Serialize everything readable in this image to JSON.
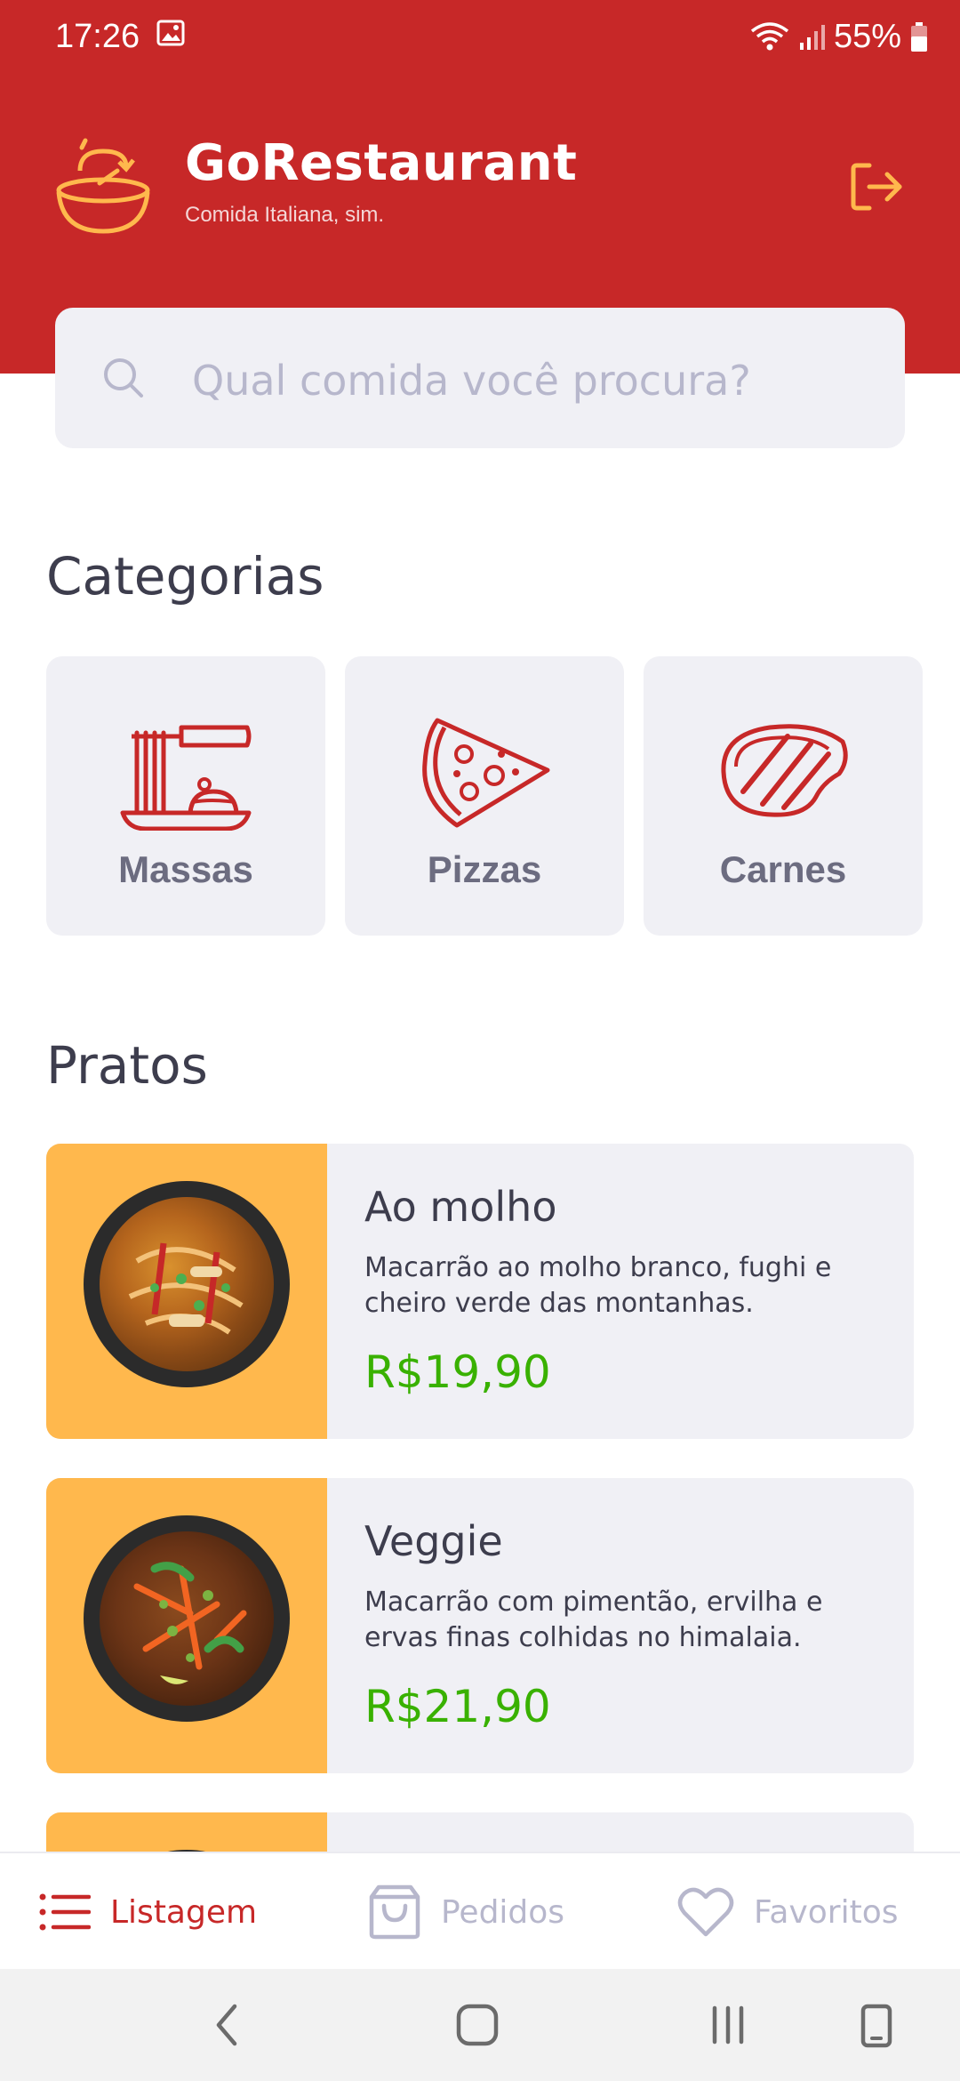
{
  "status": {
    "time": "17:26",
    "battery": "55%"
  },
  "header": {
    "title": "GoRestaurant",
    "subtitle": "Comida Italiana, sim."
  },
  "search": {
    "placeholder": "Qual comida você procura?"
  },
  "categories_section": {
    "title": "Categorias",
    "items": [
      {
        "label": "Massas",
        "icon": "pasta-icon"
      },
      {
        "label": "Pizzas",
        "icon": "pizza-icon"
      },
      {
        "label": "Carnes",
        "icon": "steak-icon"
      }
    ]
  },
  "dishes_section": {
    "title": "Pratos",
    "items": [
      {
        "name": "Ao molho",
        "description": "Macarrão ao molho branco, fughi e cheiro verde das montanhas.",
        "price": "R$19,90"
      },
      {
        "name": "Veggie",
        "description": "Macarrão com pimentão, ervilha e ervas finas colhidas no himalaia.",
        "price": "R$21,90"
      }
    ]
  },
  "tabs": [
    {
      "label": "Listagem",
      "icon": "list-icon",
      "active": true
    },
    {
      "label": "Pedidos",
      "icon": "shopping-bag-icon",
      "active": false
    },
    {
      "label": "Favoritos",
      "icon": "heart-icon",
      "active": false
    }
  ],
  "colors": {
    "primary": "#c72828",
    "accent": "#ffb84d",
    "price": "#39b100",
    "card": "#f0f0f5",
    "text": "#3d3d4d",
    "muted": "#6c6c80"
  }
}
